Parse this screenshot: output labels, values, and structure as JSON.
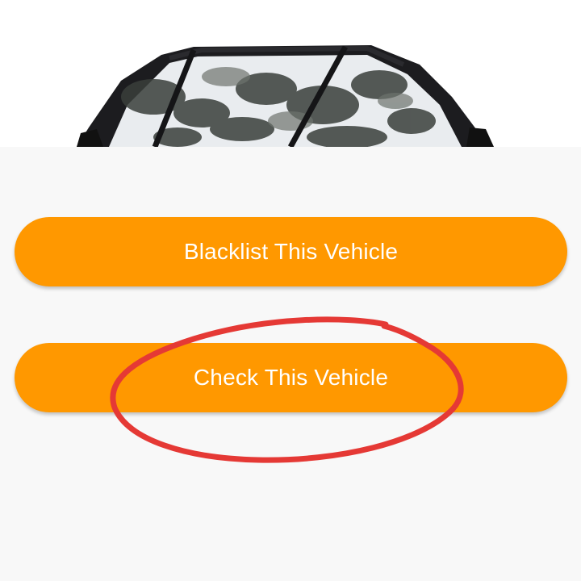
{
  "buttons": {
    "blacklist_label": "Blacklist This Vehicle",
    "check_label": "Check This Vehicle"
  },
  "colors": {
    "button_bg": "#ff9800",
    "button_text": "#ffffff",
    "background": "#f8f8f8",
    "annotation_stroke": "#e53935"
  },
  "image": {
    "subject": "car-windshield-photo"
  }
}
